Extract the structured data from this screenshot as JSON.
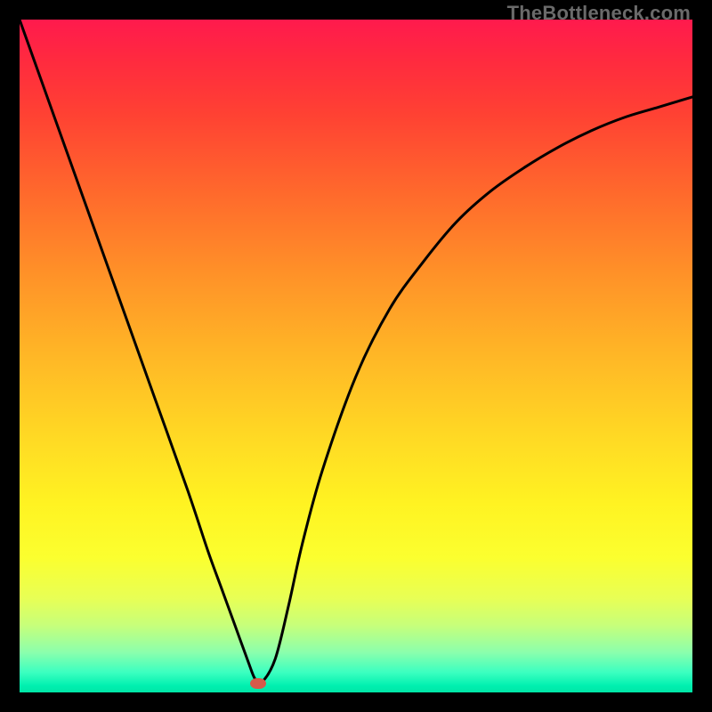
{
  "watermark": "TheBottleneck.com",
  "chart_data": {
    "type": "line",
    "title": "",
    "xlabel": "",
    "ylabel": "",
    "xlim": [
      0,
      100
    ],
    "ylim": [
      0,
      100
    ],
    "grid": false,
    "legend": false,
    "series": [
      {
        "name": "curve",
        "x": [
          0,
          5,
          10,
          15,
          20,
          25,
          28,
          30,
          32,
          34,
          35,
          36,
          38,
          40,
          42,
          45,
          50,
          55,
          60,
          65,
          70,
          75,
          80,
          85,
          90,
          95,
          100
        ],
        "y": [
          100,
          86,
          72,
          58,
          44,
          30,
          21,
          15.5,
          10,
          4.5,
          2,
          1.5,
          5,
          13,
          22,
          33,
          47,
          57,
          64,
          70,
          74.5,
          78,
          81,
          83.5,
          85.5,
          87,
          88.5
        ]
      }
    ],
    "marker": {
      "x": 35.5,
      "y": 1.3
    },
    "background_gradient": {
      "top": "#ff1a4d",
      "mid": "#ffd924",
      "bottom": "#00e6a6"
    }
  }
}
